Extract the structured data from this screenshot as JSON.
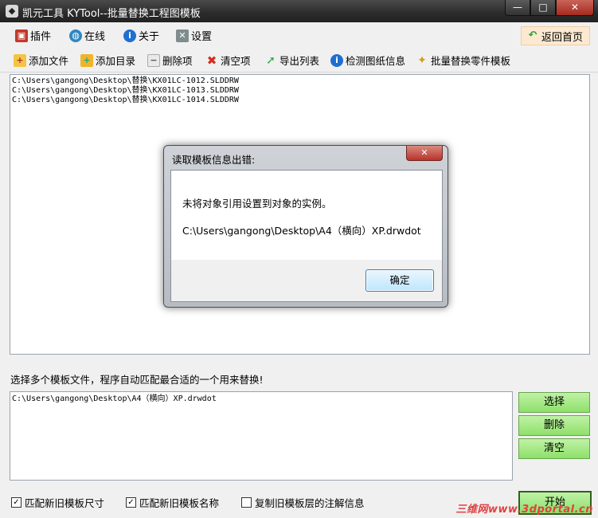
{
  "window": {
    "title": "凯元工具 KYTool--批量替换工程图模板",
    "min": "—",
    "max": "□",
    "close": "✕"
  },
  "menu": {
    "items": [
      "插件",
      "在线",
      "关于",
      "设置"
    ],
    "home": "返回首页"
  },
  "toolbar": {
    "items": [
      "添加文件",
      "添加目录",
      "删除项",
      "清空项",
      "导出列表",
      "检测图纸信息",
      "批量替换零件模板"
    ]
  },
  "file_list": [
    "C:\\Users\\gangong\\Desktop\\替换\\KX01LC-1012.SLDDRW",
    "C:\\Users\\gangong\\Desktop\\替换\\KX01LC-1013.SLDDRW",
    "C:\\Users\\gangong\\Desktop\\替换\\KX01LC-1014.SLDDRW"
  ],
  "template_hint": "选择多个模板文件，程序自动匹配最合适的一个用来替换!",
  "template_list": [
    "C:\\Users\\gangong\\Desktop\\A4（横向）XP.drwdot"
  ],
  "side_buttons": {
    "select": "选择",
    "delete": "删除",
    "clear": "清空",
    "start": "开始"
  },
  "options": [
    {
      "label": "匹配新旧模板尺寸",
      "checked": true
    },
    {
      "label": "匹配新旧模板名称",
      "checked": true
    },
    {
      "label": "复制旧模板层的注解信息",
      "checked": false
    }
  ],
  "watermark": "三维网www.3dportal.cn",
  "dialog": {
    "title": "读取模板信息出错:",
    "close": "✕",
    "message": "未将对象引用设置到对象的实例。",
    "path": "C:\\Users\\gangong\\Desktop\\A4（横向）XP.drwdot",
    "ok": "确定"
  },
  "colors": {
    "titlebar": "#2b2b2b",
    "green_button": "#8ee06a",
    "home_button": "#fde9d0",
    "close_red": "#b9332a"
  }
}
